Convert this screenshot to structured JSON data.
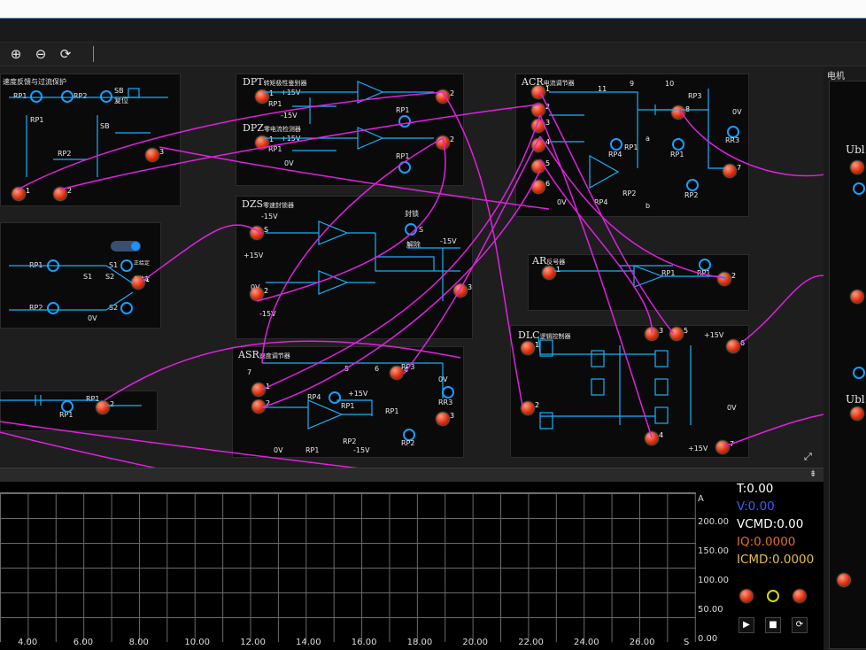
{
  "toolbar": {
    "zoom_in_icon": "⊕",
    "zoom_out_icon": "⊖",
    "reset_icon": "⟳"
  },
  "right_panel": {
    "title": "电机",
    "u1": "Ubl",
    "u2": "Ubl"
  },
  "modules": {
    "speed_feedback": {
      "title": "速度反馈与过流保护",
      "rp1": "RP1",
      "rp2": "RP2",
      "sb": "SB",
      "reset": "复位",
      "sb2": "SB"
    },
    "dpt": {
      "title": "DPT",
      "sub": "转矩极性鉴别器",
      "p15": "+15V",
      "m15": "-15V",
      "rp1": "RP1",
      "rp1b": "RP1"
    },
    "dpz": {
      "title": "DPZ",
      "sub": "零电流检测器",
      "p15": "+15V",
      "rp1": "RP1",
      "ov": "0V",
      "rp1b": "RP1"
    },
    "acr": {
      "title": "ACR",
      "sub": "电流调节器",
      "n11": "11",
      "n9": "9",
      "n10": "10",
      "rp3": "RP3",
      "ov": "0V",
      "rr3": "RR3",
      "rp1": "RP1",
      "rp4": "RP4",
      "rp2": "RP2",
      "a": "a",
      "b": "b",
      "ov2": "0V"
    },
    "dzs": {
      "title": "DZS",
      "sub": "零速封锁器",
      "m15": "-15V",
      "p15": "+15V",
      "lock": "封锁",
      "s": "S",
      "unlock": "解除",
      "m15b": "-15V",
      "ov": "0V",
      "m15c": "-15V"
    },
    "ar": {
      "title": "AR",
      "sub": "反号器",
      "rp1": "RP1",
      "rp1b": "RP1"
    },
    "dlc": {
      "title": "DLC",
      "sub": "逻辑控制器",
      "p15": "+15V",
      "p15b": "+15V",
      "ov": "0V"
    },
    "asr": {
      "title": "ASR",
      "sub": "速度调节器",
      "n5": "5",
      "n6": "6",
      "n7": "7",
      "rp3": "RP3",
      "ov": "0V",
      "rr3": "RR3",
      "rp4": "RP4",
      "p15": "+15V",
      "rp1": "RP1",
      "rp1b": "RP1",
      "rp2": "RP2",
      "rp2b": "RP2",
      "m15": "-15V",
      "ov2": "0V"
    },
    "given": {
      "rp1": "RP1",
      "s1": "S1",
      "s1b": "S1",
      "s2": "S2",
      "s2b": "S2",
      "rp2": "RP2",
      "ov": "0V",
      "pos": "正给定",
      "neg": "负给定"
    },
    "lower_left": {
      "rp1": "RP1",
      "rp1b": "RP1",
      "rp1c": "RP1"
    }
  },
  "scope": {
    "x_ticks": [
      "4.00",
      "6.00",
      "8.00",
      "10.00",
      "12.00",
      "14.00",
      "16.00",
      "18.00",
      "20.00",
      "22.00",
      "24.00",
      "26.00"
    ],
    "x_unit": "S",
    "y_unit": "A",
    "y_ticks": [
      "200.00",
      "150.00",
      "100.00",
      "50.00",
      "0.00"
    ],
    "readouts": {
      "t": "T:0.00",
      "v": "V:0.00",
      "vcmd": "VCMD:0.00",
      "iq": "IQ:0.0000",
      "icmd": "ICMD:0.0000"
    },
    "colors": {
      "t": "#ffffff",
      "v": "#3b5bff",
      "vcmd": "#ffffff",
      "iq": "#e07020",
      "icmd": "#e6c040"
    },
    "controls": {
      "play": "▶",
      "stop": "■",
      "reset": "⟳"
    }
  },
  "colors": {
    "wire": "#e020e0",
    "circuit": "#16b0ff",
    "node": "#e03010"
  }
}
